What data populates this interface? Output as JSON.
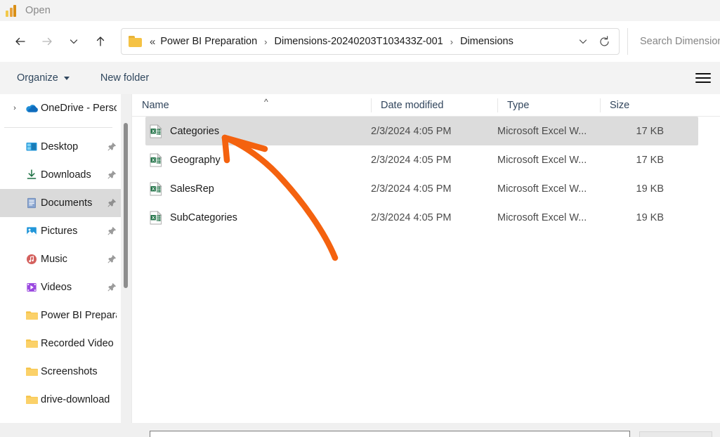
{
  "window": {
    "title": "Open",
    "app_icon": "power-bi-icon"
  },
  "nav": {
    "back": "back-arrow-icon",
    "forward": "forward-arrow-icon",
    "recent": "chevron-down-icon",
    "up": "up-arrow-icon"
  },
  "address": {
    "folder_icon": "folder-icon",
    "root_chevron": "«",
    "separator": "›",
    "crumbs": [
      "Power BI Preparation",
      "Dimensions-20240203T103433Z-001",
      "Dimensions"
    ],
    "history_dropdown": "chevron-down-icon",
    "refresh": "refresh-icon"
  },
  "search": {
    "placeholder": "Search Dimensions"
  },
  "toolbar": {
    "organize_label": "Organize",
    "new_folder_label": "New folder",
    "view_menu_icon": "hamburger-menu-icon"
  },
  "sidebar": {
    "items": [
      {
        "label": "OneDrive - Perso",
        "icon": "onedrive-cloud-icon",
        "expander": "›",
        "pinned": false,
        "selected": false,
        "type": "cloud"
      },
      {
        "label": "Desktop",
        "icon": "desktop-icon",
        "expander": "",
        "pinned": true,
        "selected": false,
        "type": "library"
      },
      {
        "label": "Downloads",
        "icon": "downloads-icon",
        "expander": "",
        "pinned": true,
        "selected": false,
        "type": "library"
      },
      {
        "label": "Documents",
        "icon": "documents-icon",
        "expander": "",
        "pinned": true,
        "selected": true,
        "type": "library"
      },
      {
        "label": "Pictures",
        "icon": "pictures-icon",
        "expander": "",
        "pinned": true,
        "selected": false,
        "type": "library"
      },
      {
        "label": "Music",
        "icon": "music-icon",
        "expander": "",
        "pinned": true,
        "selected": false,
        "type": "library"
      },
      {
        "label": "Videos",
        "icon": "videos-icon",
        "expander": "",
        "pinned": true,
        "selected": false,
        "type": "library"
      },
      {
        "label": "Power BI Prepara",
        "icon": "folder-icon",
        "expander": "",
        "pinned": false,
        "selected": false,
        "type": "folder"
      },
      {
        "label": "Recorded Video",
        "icon": "folder-icon",
        "expander": "",
        "pinned": false,
        "selected": false,
        "type": "folder"
      },
      {
        "label": "Screenshots",
        "icon": "folder-icon",
        "expander": "",
        "pinned": false,
        "selected": false,
        "type": "folder"
      },
      {
        "label": "drive-download",
        "icon": "folder-icon",
        "expander": "",
        "pinned": false,
        "selected": false,
        "type": "folder"
      }
    ]
  },
  "filelist": {
    "columns": {
      "name": "Name",
      "date_modified": "Date modified",
      "type": "Type",
      "size": "Size"
    },
    "sort_indicator": "^",
    "rows": [
      {
        "name": "Categories",
        "date": "2/3/2024 4:05 PM",
        "type": "Microsoft Excel W...",
        "size": "17 KB",
        "icon": "excel-file-icon",
        "selected": true
      },
      {
        "name": "Geography",
        "date": "2/3/2024 4:05 PM",
        "type": "Microsoft Excel W...",
        "size": "17 KB",
        "icon": "excel-file-icon",
        "selected": false
      },
      {
        "name": "SalesRep",
        "date": "2/3/2024 4:05 PM",
        "type": "Microsoft Excel W...",
        "size": "19 KB",
        "icon": "excel-file-icon",
        "selected": false
      },
      {
        "name": "SubCategories",
        "date": "2/3/2024 4:05 PM",
        "type": "Microsoft Excel W...",
        "size": "19 KB",
        "icon": "excel-file-icon",
        "selected": false
      }
    ]
  },
  "annotation": {
    "type": "hand-drawn-arrow",
    "color": "#f4620f",
    "points_at": "Categories"
  },
  "colors": {
    "selection": "#dcdcdc",
    "titlebar_bg": "#f3f3f3",
    "toolbar_bg": "#f3f3f3",
    "accent_text": "#30475e",
    "excel_green": "#1d7044",
    "folder_yellow": "#f5c244"
  }
}
